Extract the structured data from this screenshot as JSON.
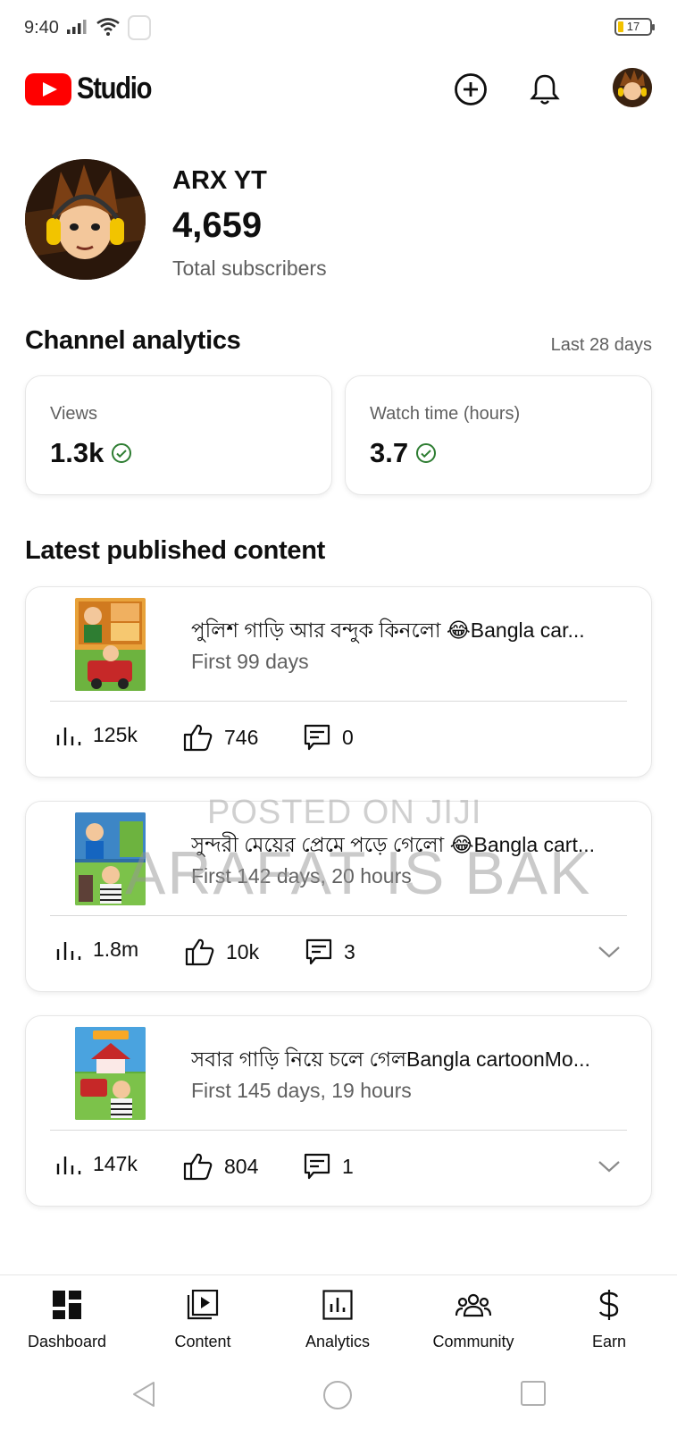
{
  "status_bar": {
    "time": "9:40",
    "battery": "17"
  },
  "header": {
    "app_name": "Studio",
    "icons": [
      "create-icon",
      "notifications-icon",
      "account-avatar"
    ]
  },
  "channel": {
    "name": "ARX YT",
    "subscribers": "4,659",
    "subscribers_label": "Total subscribers"
  },
  "analytics": {
    "title": "Channel analytics",
    "period": "Last 28 days",
    "cards": [
      {
        "label": "Views",
        "value": "1.3k"
      },
      {
        "label": "Watch time (hours)",
        "value": "3.7"
      }
    ]
  },
  "latest": {
    "title": "Latest published content",
    "videos": [
      {
        "title": "পুলিশ গাড়ি আর বন্দুক কিনলো 😂Bangla car...",
        "period": "First 99 days",
        "views": "125k",
        "likes": "746",
        "comments": "0",
        "expandable": false
      },
      {
        "title": "সুন্দরী মেয়ের প্রেমে পড়ে গেলো 😂Bangla cart...",
        "period": "First 142 days, 20 hours",
        "views": "1.8m",
        "likes": "10k",
        "comments": "3",
        "expandable": true
      },
      {
        "title": "সবার  গাড়ি নিয়ে চলে গেলBangla cartoonMo...",
        "period": "First 145 days, 19 hours",
        "views": "147k",
        "likes": "804",
        "comments": "1",
        "expandable": true
      }
    ]
  },
  "watermark": {
    "line1": "POSTED ON JIJI",
    "line2": "ARAFAT IS BAK"
  },
  "bottom_nav": [
    {
      "label": "Dashboard",
      "icon": "dashboard-icon"
    },
    {
      "label": "Content",
      "icon": "content-icon"
    },
    {
      "label": "Analytics",
      "icon": "analytics-icon"
    },
    {
      "label": "Community",
      "icon": "community-icon"
    },
    {
      "label": "Earn",
      "icon": "earn-icon"
    }
  ],
  "colors": {
    "brand_red": "#ff0000",
    "check_green": "#2e7d32",
    "secondary_text": "#606060"
  }
}
